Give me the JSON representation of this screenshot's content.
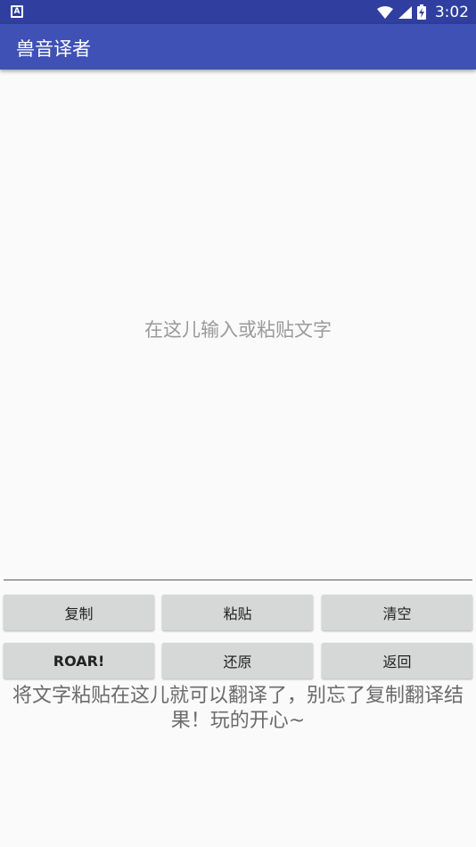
{
  "status_bar": {
    "left_icon_letter": "A",
    "time": "3:02",
    "icons": [
      "wifi-icon",
      "signal-icon",
      "battery-charging-icon"
    ]
  },
  "app_bar": {
    "title": "兽音译者"
  },
  "input": {
    "placeholder": "在这儿输入或粘贴文字",
    "value": ""
  },
  "buttons": {
    "copy": "复制",
    "paste": "粘贴",
    "clear": "清空",
    "roar": "ROAR!",
    "restore": "还原",
    "back": "返回"
  },
  "hint": "将文字粘贴在这儿就可以翻译了，别忘了复制翻译结果！玩的开心~",
  "colors": {
    "status_bar": "#303f9f",
    "app_bar": "#3f51b5",
    "button_bg": "#d6d7d7",
    "background": "#fafafa"
  }
}
